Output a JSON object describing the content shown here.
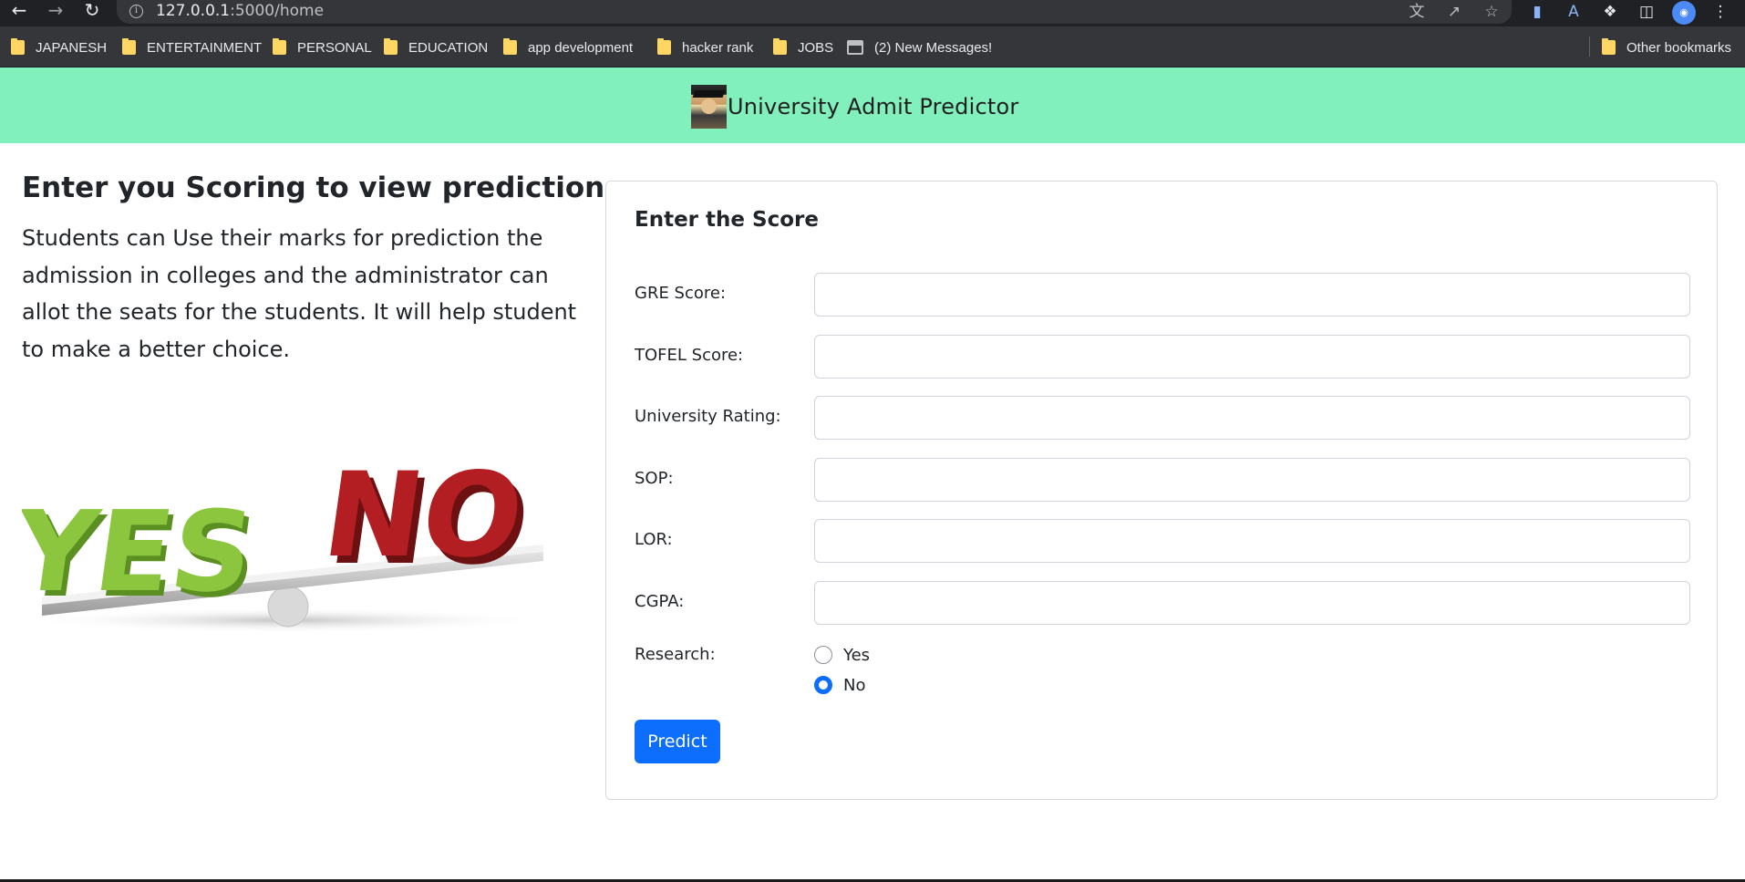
{
  "browser": {
    "url_host": "127.0.0.1",
    "url_path": ":5000/home",
    "nav_icons": [
      "back-icon",
      "forward-icon",
      "reload-icon",
      "info-icon"
    ],
    "toolbar_icons": [
      "translate-icon",
      "share-icon",
      "star-icon",
      "docs-extension-icon",
      "font-extension-icon",
      "extensions-puzzle-icon",
      "side-panel-icon",
      "profile-avatar-icon",
      "menu-dots-icon"
    ]
  },
  "bookmarks": {
    "items": [
      {
        "label": "JAPANESH",
        "icon": "folder-icon"
      },
      {
        "label": "ENTERTAINMENT",
        "icon": "folder-icon"
      },
      {
        "label": "PERSONAL",
        "icon": "folder-icon"
      },
      {
        "label": "EDUCATION",
        "icon": "folder-icon"
      },
      {
        "label": "app development",
        "icon": "folder-icon"
      },
      {
        "label": "hacker rank",
        "icon": "folder-icon"
      },
      {
        "label": "JOBS",
        "icon": "folder-icon"
      },
      {
        "label": "(2) New Messages!",
        "icon": "clapperboard-icon"
      }
    ],
    "other": {
      "label": "Other bookmarks",
      "icon": "folder-icon"
    }
  },
  "header": {
    "brand": "University Admit Predictor"
  },
  "intro": {
    "title": "Enter you Scoring to view prediction",
    "text": "Students can Use their marks for prediction the admission in colleges and the administrator can allot the seats for the students. It will help student to make a better choice.",
    "image": {
      "yes_text": "YES",
      "no_text": "NO"
    }
  },
  "form": {
    "title": "Enter the Score",
    "fields": [
      {
        "label": "GRE Score:",
        "value": ""
      },
      {
        "label": "TOFEL Score:",
        "value": ""
      },
      {
        "label": "University Rating:",
        "value": ""
      },
      {
        "label": "SOP:",
        "value": ""
      },
      {
        "label": "LOR:",
        "value": ""
      },
      {
        "label": "CGPA:",
        "value": ""
      }
    ],
    "research": {
      "label": "Research:",
      "options": [
        {
          "label": "Yes",
          "checked": false
        },
        {
          "label": "No",
          "checked": true
        }
      ]
    },
    "submit_label": "Predict"
  },
  "colors": {
    "header_bg": "#82f0bd",
    "primary": "#0d6efd",
    "yes_green": "#8cc63f",
    "no_red": "#b21e22"
  }
}
